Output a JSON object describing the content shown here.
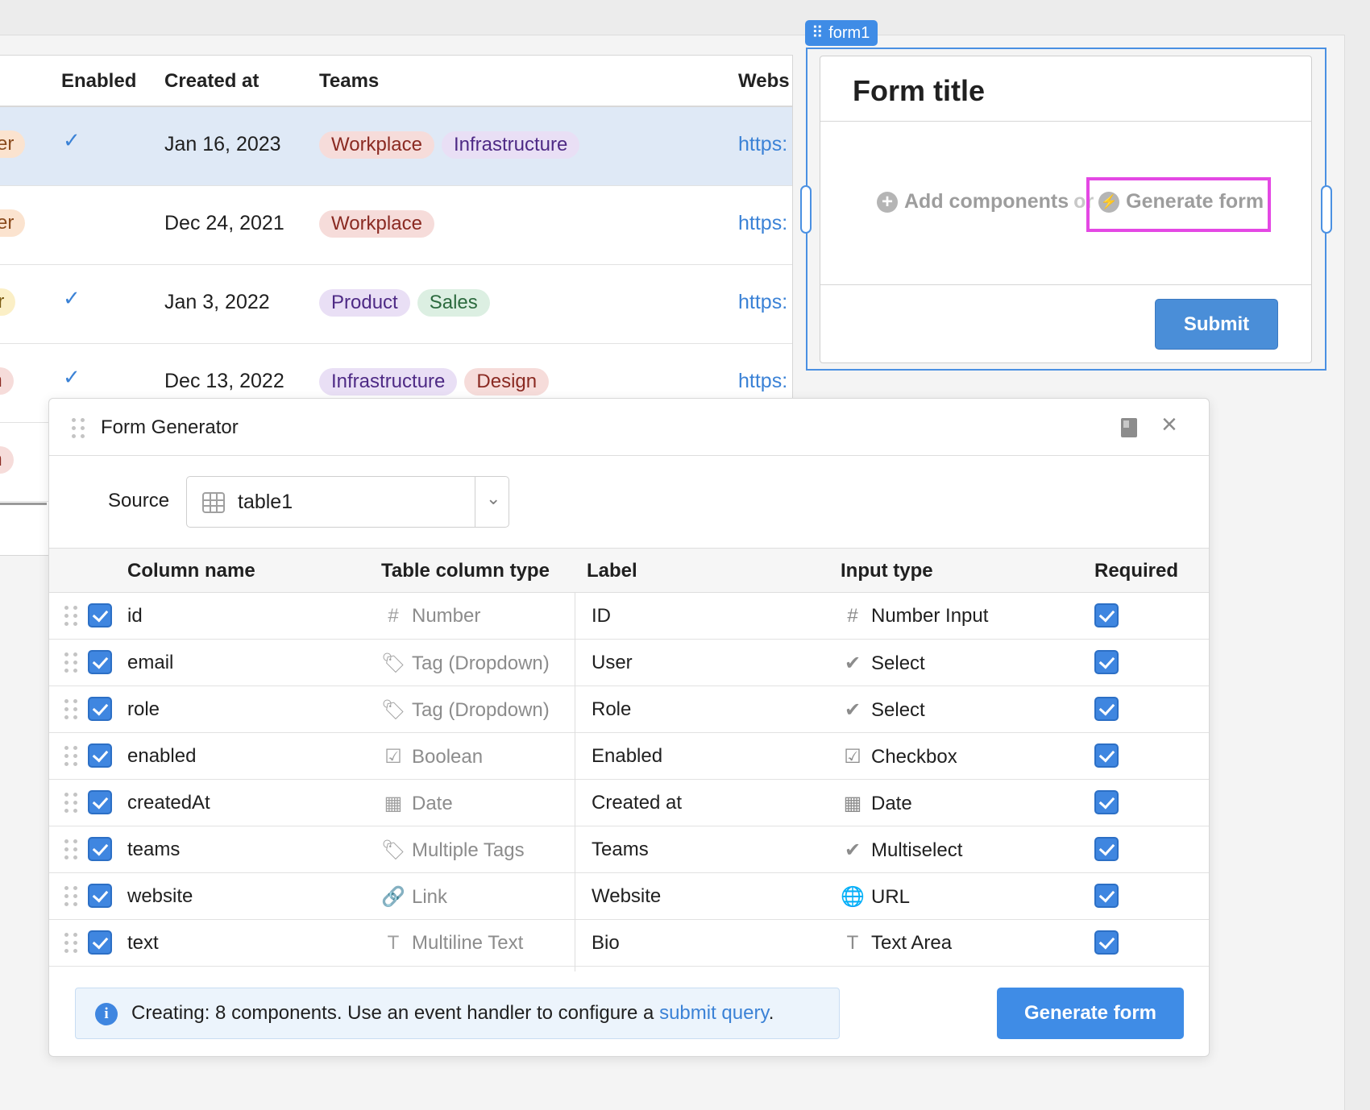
{
  "background_table": {
    "headers": {
      "enabled": "Enabled",
      "created_at": "Created at",
      "teams": "Teams",
      "website": "Webs"
    },
    "rows": [
      {
        "role": "ver",
        "role_bg": "#fbe3cf",
        "role_color": "#8a4a1c",
        "enabled": "✓",
        "created": "Jan 16, 2023",
        "teams": [
          {
            "label": "Workplace",
            "bg": "#f6dcda",
            "color": "#8a2a22"
          },
          {
            "label": "Infrastructure",
            "bg": "#e9dff5",
            "color": "#4e2a85"
          }
        ],
        "website": "https:",
        "selected": true
      },
      {
        "role": "ver",
        "role_bg": "#fbe3cf",
        "role_color": "#8a4a1c",
        "enabled": "",
        "created": "Dec 24, 2021",
        "teams": [
          {
            "label": "Workplace",
            "bg": "#f6dcda",
            "color": "#8a2a22"
          }
        ],
        "website": "https:",
        "selected": false
      },
      {
        "role": "or",
        "role_bg": "#fbefc6",
        "role_color": "#7a5a12",
        "enabled": "✓",
        "created": "Jan 3, 2022",
        "teams": [
          {
            "label": "Product",
            "bg": "#e9dff5",
            "color": "#4e2a85"
          },
          {
            "label": "Sales",
            "bg": "#dcefe2",
            "color": "#2c6a3e"
          }
        ],
        "website": "https:",
        "selected": false
      },
      {
        "role": "in",
        "role_bg": "#f6dcda",
        "role_color": "#8a2a22",
        "enabled": "✓",
        "created": "Dec 13, 2022",
        "teams": [
          {
            "label": "Infrastructure",
            "bg": "#e9dff5",
            "color": "#4e2a85"
          },
          {
            "label": "Design",
            "bg": "#f6dcda",
            "color": "#8a2a22"
          }
        ],
        "website": "https:",
        "selected": false
      },
      {
        "role": "in",
        "role_bg": "#f6dcda",
        "role_color": "#8a2a22",
        "enabled": "",
        "created": "",
        "teams": [],
        "website": "",
        "selected": false
      }
    ]
  },
  "form1": {
    "label": "form1",
    "title": "Form title",
    "add_components": "Add components",
    "or": "or",
    "generate_form_link": "Generate form",
    "submit": "Submit"
  },
  "dialog": {
    "title": "Form Generator",
    "source_label": "Source",
    "source_value": "table1",
    "columns": {
      "column_name": "Column name",
      "table_column_type": "Table column type",
      "label": "Label",
      "input_type": "Input type",
      "required": "Required"
    },
    "rows": [
      {
        "name": "id",
        "type_icon": "#",
        "type": "Number",
        "label": "ID",
        "input_icon": "#",
        "input_type": "Number Input"
      },
      {
        "name": "email",
        "type_icon": "🏷",
        "type": "Tag (Dropdown)",
        "label": "User",
        "input_icon": "✔",
        "input_type": "Select"
      },
      {
        "name": "role",
        "type_icon": "🏷",
        "type": "Tag (Dropdown)",
        "label": "Role",
        "input_icon": "✔",
        "input_type": "Select"
      },
      {
        "name": "enabled",
        "type_icon": "☑",
        "type": "Boolean",
        "label": "Enabled",
        "input_icon": "☑",
        "input_type": "Checkbox"
      },
      {
        "name": "createdAt",
        "type_icon": "▦",
        "type": "Date",
        "label": "Created at",
        "input_icon": "▦",
        "input_type": "Date"
      },
      {
        "name": "teams",
        "type_icon": "🏷",
        "type": "Multiple Tags",
        "label": "Teams",
        "input_icon": "✔",
        "input_type": "Multiselect"
      },
      {
        "name": "website",
        "type_icon": "🔗",
        "type": "Link",
        "label": "Website",
        "input_icon": "🌐",
        "input_type": "URL"
      },
      {
        "name": "text",
        "type_icon": "T",
        "type": "Multiline Text",
        "label": "Bio",
        "input_icon": "T",
        "input_type": "Text Area"
      }
    ],
    "info_prefix": "Creating: 8 components. Use an event handler to configure a ",
    "info_link": "submit query",
    "info_suffix": ".",
    "generate_button": "Generate form"
  },
  "colors": {
    "accent": "#3f8ce6",
    "highlight": "#e448e4",
    "selected_row": "#dfe9f6"
  }
}
